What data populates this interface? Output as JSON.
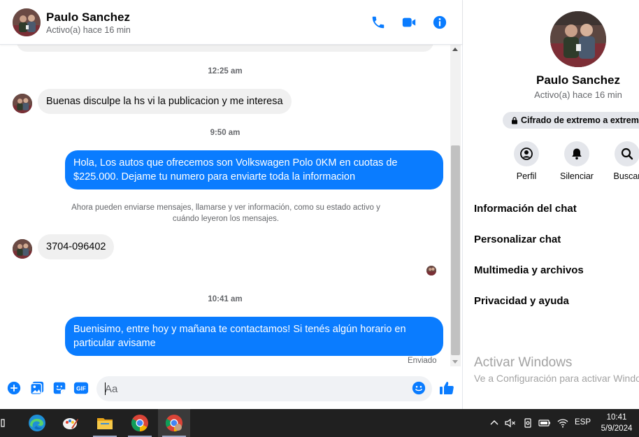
{
  "colors": {
    "accent": "#0a7cff",
    "incoming_bubble": "#f0f0f0",
    "secondary_text": "#65676b",
    "taskbar": "#202020"
  },
  "header": {
    "name": "Paulo Sanchez",
    "status": "Activo(a) hace 16 min",
    "icons": [
      "phone-icon",
      "video-camera-icon",
      "info-icon"
    ]
  },
  "messages": {
    "time_1": "12:25 am",
    "msg_1": "Buenas disculpe la hs vi la publicacion y me interesa",
    "time_2": "9:50 am",
    "msg_2": "Hola, Los autos que ofrecemos son Volkswagen Polo 0KM en cuotas de $225.000. Dejame tu numero para enviarte toda la informacion",
    "system_note": "Ahora pueden enviarse mensajes, llamarse y ver información, como su estado activo y cuándo leyeron los mensajes.",
    "msg_3": "3704-096402",
    "time_3": "10:41 am",
    "msg_4": "Buenisimo, entre hoy y mañana te contactamos! Si tenés algún horario en particular avisame",
    "sent_status": "Enviado"
  },
  "composer": {
    "placeholder": "Aa",
    "gif_label": "GIF",
    "icons": [
      "plus-circle-icon",
      "image-icon",
      "sticker-icon",
      "gif-icon",
      "emoji-icon",
      "thumbs-up-icon"
    ]
  },
  "info_panel": {
    "name": "Paulo Sanchez",
    "status": "Activo(a) hace 16 min",
    "encryption": "Cifrado de extremo a extremo",
    "actions": [
      {
        "label": "Perfil",
        "icon": "profile-icon"
      },
      {
        "label": "Silenciar",
        "icon": "bell-icon"
      },
      {
        "label": "Buscar",
        "icon": "search-icon"
      }
    ],
    "menu": [
      "Información del chat",
      "Personalizar chat",
      "Multimedia y archivos",
      "Privacidad y ayuda"
    ]
  },
  "watermark": {
    "title": "Activar Windows",
    "subtitle": "Ve a Configuración para activar Windows."
  },
  "taskbar": {
    "apps": [
      "task-view-icon",
      "edge-icon",
      "paint-icon",
      "file-explorer-icon",
      "chrome-icon",
      "chrome-profile-icon"
    ],
    "language": "ESP",
    "time": "10:41",
    "date": "5/9/2024"
  }
}
